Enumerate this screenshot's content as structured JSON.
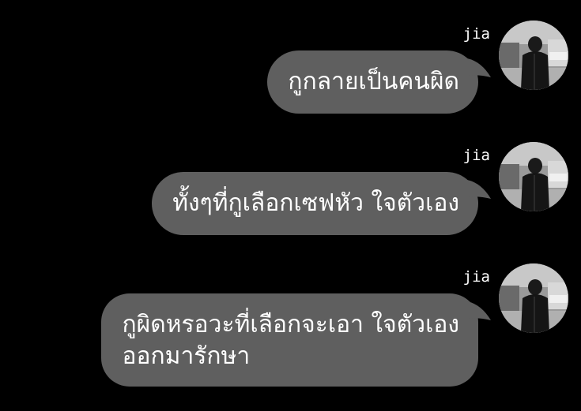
{
  "messages": [
    {
      "sender": "jia",
      "text": "กูกลายเป็นคนผิด",
      "avatar_icon": "person-back-photo-icon"
    },
    {
      "sender": "jia",
      "text": "ทั้งๆที่กูเลือกเซฟหัว ใจตัวเอง",
      "avatar_icon": "person-back-photo-icon"
    },
    {
      "sender": "jia",
      "text_line1": "กูผิดหรอวะที่เลือกจะเอา ใจตัวเอง",
      "text_line2": "ออกมารักษา",
      "avatar_icon": "person-back-photo-icon"
    }
  ],
  "colors": {
    "background": "#000000",
    "bubble": "#5f5f5f",
    "text": "#ffffff"
  }
}
